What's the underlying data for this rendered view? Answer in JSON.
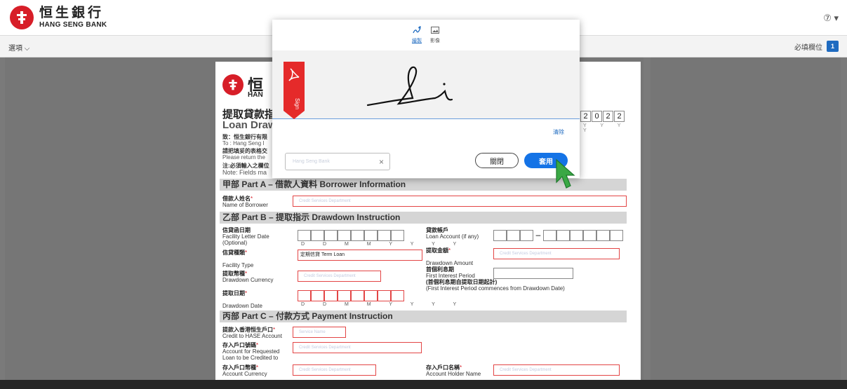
{
  "header": {
    "brand_zh": "恒生銀行",
    "brand_en": "HANG SENG BANK",
    "help": "⑦ ▾"
  },
  "subbar": {
    "options": "選項 ⌵",
    "required_label": "必填欄位",
    "required_count": "1"
  },
  "document": {
    "logo_char": "恒",
    "logo_zh": "恒",
    "logo_en": "HAN",
    "title_zh": "提取貸款指",
    "title_en": "Loan Draw",
    "to_zh": "致：恒生銀行有限",
    "to_en": "To : Hang Seng I",
    "return_zh": "請把填妥的表格交",
    "return_en": "Please return the",
    "note_zh": "注:必須輸入之欄位",
    "note_en": "Note: Fields ma",
    "year_digits": [
      "2",
      "0",
      "2",
      "2"
    ],
    "year_label": "Y Y Y Y",
    "part_a": "甲部 Part A – 借款人資料 Borrower Information",
    "borrower_zh": "借款人姓名",
    "borrower_en": "Name of Borrower",
    "borrower_value": "Credit Services Department",
    "part_b": "乙部 Part B – 提取指示 Drawdown Instruction",
    "facility_date_zh": "信貸函日期",
    "facility_date_en": "Facility Letter Date",
    "facility_date_opt": "(Optional)",
    "date_label": "D D M M Y Y Y Y",
    "facility_type_zh": "信貸種類",
    "facility_type_en": "Facility Type",
    "facility_type_value": "定期信貸 Term Loan",
    "currency_zh": "提取幣種",
    "currency_en": "Drawdown Currency",
    "currency_value": "Credit Services Department",
    "drawdown_date_zh": "提取日期",
    "drawdown_date_en": "Drawdown Date",
    "loan_acct_zh": "貸款帳戶",
    "loan_acct_en": "Loan Account (if any)",
    "amount_zh": "提取金額",
    "amount_en": "Drawdown Amount",
    "amount_value": "Credit Services Department",
    "interest_zh": "首個利息期",
    "interest_en": "First Interest Period",
    "interest_note_zh": "(首個利息期自提取日期起計)",
    "interest_note_en": "(First Interest Period commences from Drawdown Date)",
    "part_c": "丙部 Part C – 付款方式 Payment Instruction",
    "credit_zh": "提款入香港恒生戶口",
    "credit_en": "Credit to HASE Account",
    "credit_value": "Service Name",
    "acct_no_zh": "存入戶口號碼",
    "acct_no_en1": "Account for Requested",
    "acct_no_en2": "Loan to be Credited to",
    "acct_no_value": "Credit Services Department",
    "acct_ccy_zh": "存入戶口幣種",
    "acct_ccy_en": "Account Currency",
    "acct_ccy_value": "Credit Services Department",
    "holder_zh": "存入戶口名稱",
    "holder_en": "Account Holder Name",
    "holder_value": "Credit Services Department",
    "req_mark": "*",
    "dash": "–"
  },
  "modal": {
    "tab_draw": "繪製",
    "tab_image": "影像",
    "flag_text": "Sign",
    "clear": "清除",
    "name_value": "Hang Seng Bank",
    "close": "關閉",
    "apply": "套用"
  },
  "colors": {
    "brand_red": "#d71e28",
    "accent_blue": "#1473e6",
    "cursor_green": "#3aa845"
  },
  "icons": [
    "draw-icon",
    "image-icon",
    "acrobat-icon",
    "close-x-icon",
    "help-icon",
    "cursor-arrow-icon"
  ]
}
